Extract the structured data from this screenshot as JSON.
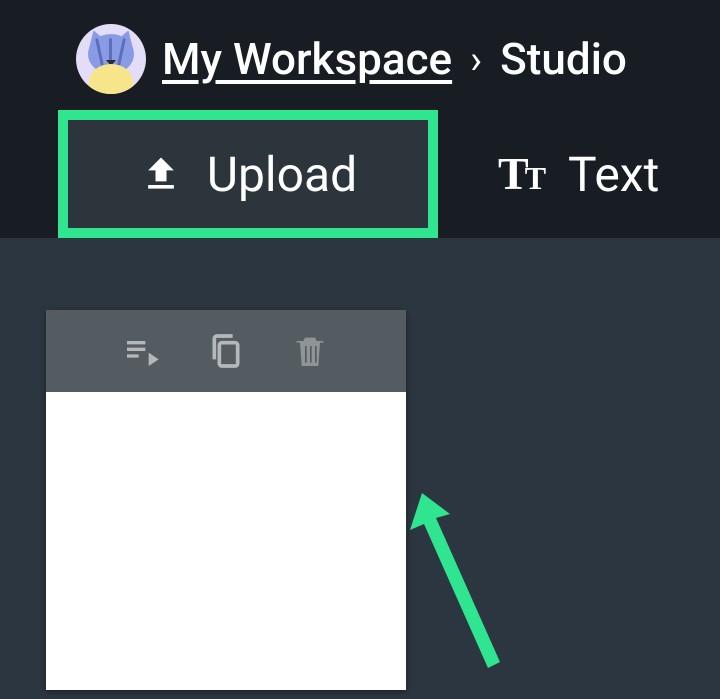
{
  "breadcrumb": {
    "workspace_label": "My Workspace",
    "separator": "›",
    "current": "Studio"
  },
  "tabs": {
    "upload_label": "Upload",
    "text_label": "Text"
  },
  "card_toolbar": {
    "queue_icon": "playlist-play-icon",
    "copy_icon": "copy-icon",
    "delete_icon": "trash-icon"
  },
  "colors": {
    "highlight": "#2fe58f",
    "header_bg": "#181d23",
    "body_bg": "#2c3640",
    "toolbar_bg": "#545b61"
  }
}
